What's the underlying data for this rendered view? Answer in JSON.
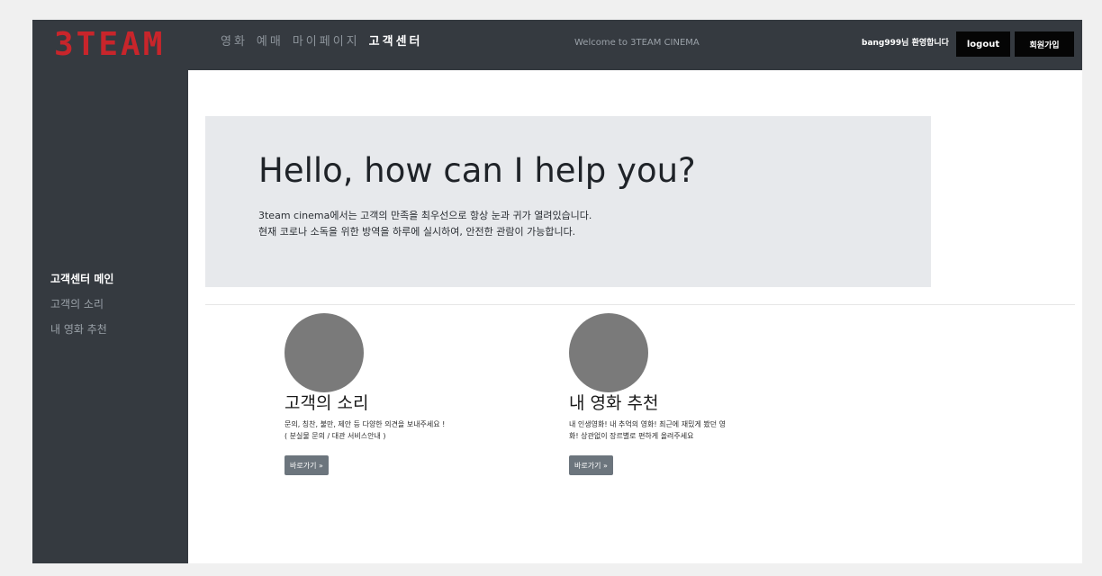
{
  "navbar": {
    "logo": "3TEAM",
    "links": [
      "영화",
      "예매",
      "마이페이지",
      "고객센터"
    ],
    "active_link": "고객센터",
    "welcome": "Welcome to 3TEAM CINEMA",
    "user_greeting": "bang999님 환영합니다",
    "logout_label": "logout",
    "signup_label": "회원가입"
  },
  "sidebar": {
    "items": [
      "고객센터 메인",
      "고객의 소리",
      "내 영화 추천"
    ],
    "active_item": "고객센터 메인"
  },
  "hero": {
    "title": "Hello, how can I help you?",
    "line1": "3team cinema에서는 고객의 만족을 최우선으로 항상 눈과 귀가 열려있습니다.",
    "line2": "현재 코로나 소독을 위한 방역을 하루에 실시하여, 안전한 관람이 가능합니다."
  },
  "cards": [
    {
      "title": "고객의 소리",
      "desc_line1": "문의, 칭찬, 불만, 제안 등 다양한 의견을 보내주세요 !",
      "desc_line2": "( 분실물 문의 / 대관 서비스안내 )",
      "button": "바로가기 »"
    },
    {
      "title": "내 영화 추천",
      "desc_line1": "내 인생영화! 내 추억의 영화! 최근에 재밌게 봤던 영",
      "desc_line2": "화! 상관없이 장르별로 편하게 올려주세요",
      "button": "바로가기 »"
    }
  ],
  "colors": {
    "navbar_bg": "#353a40",
    "logo_red": "#c8252b",
    "jumbotron_bg": "#e7e9ec",
    "button_gray": "#6c757d",
    "circle_gray": "#7a7a7a"
  }
}
